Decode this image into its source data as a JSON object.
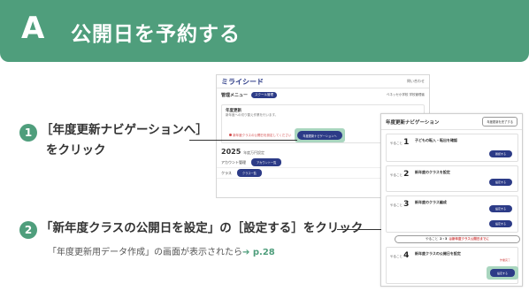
{
  "header": {
    "letter": "A",
    "title": "公開日を予約する"
  },
  "steps": [
    {
      "num": "1",
      "line1": "［年度更新ナビゲーションへ］",
      "line2": "をクリック"
    },
    {
      "num": "2",
      "line1": "「新年度クラスの公開日を設定」の［設定する］をクリック",
      "note": "「年度更新用データ作成」の画面が表示されたら",
      "note_ref": "➔ p.28"
    }
  ],
  "screenshot1": {
    "logo": "ミライシード",
    "topbar_right": "問い合わせ",
    "menu_label": "管理メニュー",
    "menu_pill": "スクール管理",
    "menu_right": "ベネッセ小学校 学校管理者",
    "panel_title": "年度更新",
    "panel_text": "新年度への切り替え作業を行います。",
    "warn_text": "新年度クラスの公開日を設定してください",
    "navi_button": "年度更新ナビゲーションへ",
    "year": "2025",
    "year_suffix": "年度万円設定",
    "rows": [
      {
        "label": "アカウント管理",
        "btn": "アカウント一覧"
      },
      {
        "label": "クラス",
        "btn": "クラス一覧"
      }
    ]
  },
  "screenshot2": {
    "title": "年度更新ナビゲーション",
    "head_button": "年度更新を完了する",
    "steps": [
      {
        "year": "1",
        "title": "子どもの転入・転出を確認",
        "btn": "確認する"
      },
      {
        "year": "2",
        "title": "新年度のクラスを設定",
        "btn": "設定する"
      },
      {
        "year": "3",
        "title": "新年度のクラス編成",
        "btn": "設定する"
      },
      {
        "year": "4",
        "title": "新年度クラスの公開日を設定",
        "btn": "設定する"
      }
    ],
    "year_label": "やること",
    "divider_text": "やること",
    "divider_mid": "2・3",
    "divider_red": "は新年度クラス公開日までに",
    "done_label": "作業完了",
    "set_button": "設定する"
  }
}
